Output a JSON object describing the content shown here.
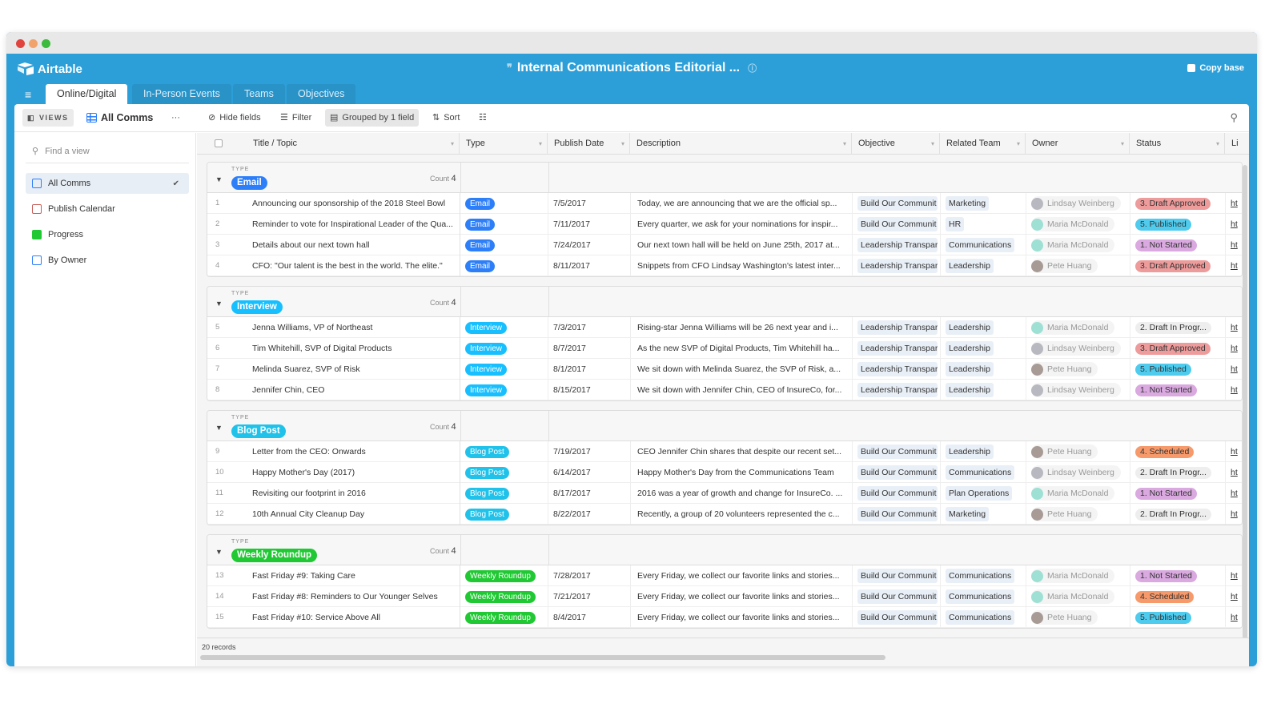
{
  "app": {
    "name": "Airtable",
    "base_title": "Internal Communications Editorial ...",
    "copy_base": "Copy base"
  },
  "tabs": [
    {
      "label": "Online/Digital",
      "active": true
    },
    {
      "label": "In-Person Events",
      "active": false
    },
    {
      "label": "Teams",
      "active": false
    },
    {
      "label": "Objectives",
      "active": false
    }
  ],
  "toolbar": {
    "views_label": "VIEWS",
    "current_view": "All Comms",
    "more": "···",
    "hide_fields": "Hide fields",
    "filter": "Filter",
    "grouped": "Grouped by 1 field",
    "sort": "Sort"
  },
  "sidebar": {
    "find_placeholder": "Find a view",
    "views": [
      {
        "label": "All Comms",
        "icon": "grid",
        "selected": true
      },
      {
        "label": "Publish Calendar",
        "icon": "calendar",
        "selected": false
      },
      {
        "label": "Progress",
        "icon": "kanban",
        "selected": false
      },
      {
        "label": "By Owner",
        "icon": "grid",
        "selected": false
      }
    ]
  },
  "columns": [
    "Title / Topic",
    "Type",
    "Publish Date",
    "Description",
    "Objective",
    "Related Team",
    "Owner",
    "Status",
    "Li"
  ],
  "colors": {
    "Email": "#2d7ff9",
    "Interview": "#18bfff",
    "Blog Post": "#20c2ea",
    "Weekly Roundup": "#20c933",
    "1. Not Started": "#d9a9e0",
    "2. Draft In Progr...": "#eeeeee",
    "3. Draft Approved": "#ee9b9b",
    "4. Scheduled": "#f79a6b",
    "5. Published": "#4fcbee",
    "Lindsay Weinberg": "#b8b8c0",
    "Maria McDonald": "#9ee0d3",
    "Pete Huang": "#a89b96"
  },
  "group_label": "TYPE",
  "count_label": "Count",
  "groups": [
    {
      "type": "Email",
      "count": "4",
      "rows": [
        {
          "n": "1",
          "title": "Announcing our sponsorship of the 2018 Steel Bowl",
          "date": "7/5/2017",
          "desc": "Today, we are announcing that we are the official sp...",
          "objective": "Build Our Communit",
          "team": "Marketing",
          "owner": "Lindsay Weinberg",
          "status": "3. Draft Approved"
        },
        {
          "n": "2",
          "title": "Reminder to vote for Inspirational Leader of the Qua...",
          "date": "7/11/2017",
          "desc": "Every quarter, we ask for your nominations for inspir...",
          "objective": "Build Our Communit",
          "team": "HR",
          "owner": "Maria McDonald",
          "status": "5. Published"
        },
        {
          "n": "3",
          "title": "Details about our next town hall",
          "date": "7/24/2017",
          "desc": "Our next town hall will be held on June 25th, 2017 at...",
          "objective": "Leadership Transpar",
          "team": "Communications",
          "owner": "Maria McDonald",
          "status": "1. Not Started"
        },
        {
          "n": "4",
          "title": "CFO: \"Our talent is the best in the world. The elite.\"",
          "date": "8/11/2017",
          "desc": "Snippets from CFO Lindsay Washington's latest inter...",
          "objective": "Leadership Transpar",
          "team": "Leadership",
          "owner": "Pete Huang",
          "status": "3. Draft Approved"
        }
      ]
    },
    {
      "type": "Interview",
      "count": "4",
      "rows": [
        {
          "n": "5",
          "title": "Jenna Williams, VP of Northeast",
          "date": "7/3/2017",
          "desc": "Rising-star Jenna Williams will be 26 next year and i...",
          "objective": "Leadership Transpar",
          "team": "Leadership",
          "owner": "Maria McDonald",
          "status": "2. Draft In Progr..."
        },
        {
          "n": "6",
          "title": "Tim Whitehill, SVP of Digital Products",
          "date": "8/7/2017",
          "desc": "As the new SVP of Digital Products, Tim Whitehill ha...",
          "objective": "Leadership Transpar",
          "team": "Leadership",
          "owner": "Lindsay Weinberg",
          "status": "3. Draft Approved"
        },
        {
          "n": "7",
          "title": "Melinda Suarez, SVP of Risk",
          "date": "8/1/2017",
          "desc": "We sit down with Melinda Suarez, the SVP of Risk, a...",
          "objective": "Leadership Transpar",
          "team": "Leadership",
          "owner": "Pete Huang",
          "status": "5. Published"
        },
        {
          "n": "8",
          "title": "Jennifer Chin, CEO",
          "date": "8/15/2017",
          "desc": "We sit down with Jennifer Chin, CEO of InsureCo, for...",
          "objective": "Leadership Transpar",
          "team": "Leadership",
          "owner": "Lindsay Weinberg",
          "status": "1. Not Started"
        }
      ]
    },
    {
      "type": "Blog Post",
      "count": "4",
      "rows": [
        {
          "n": "9",
          "title": "Letter from the CEO: Onwards",
          "date": "7/19/2017",
          "desc": "CEO Jennifer Chin shares that despite our recent set...",
          "objective": "Build Our Communit",
          "team": "Leadership",
          "owner": "Pete Huang",
          "status": "4. Scheduled"
        },
        {
          "n": "10",
          "title": "Happy Mother's Day (2017)",
          "date": "6/14/2017",
          "desc": "Happy Mother's Day from the Communications Team",
          "objective": "Build Our Communit",
          "team": "Communications",
          "owner": "Lindsay Weinberg",
          "status": "2. Draft In Progr..."
        },
        {
          "n": "11",
          "title": "Revisiting our footprint in 2016",
          "date": "8/17/2017",
          "desc": "2016 was a year of growth and change for InsureCo. ...",
          "objective": "Build Our Communit",
          "team": "Plan Operations",
          "owner": "Maria McDonald",
          "status": "1. Not Started"
        },
        {
          "n": "12",
          "title": "10th Annual City Cleanup Day",
          "date": "8/22/2017",
          "desc": "Recently, a group of 20 volunteers represented the c...",
          "objective": "Build Our Communit",
          "team": "Marketing",
          "owner": "Pete Huang",
          "status": "2. Draft In Progr..."
        }
      ]
    },
    {
      "type": "Weekly Roundup",
      "count": "4",
      "rows": [
        {
          "n": "13",
          "title": "Fast Friday #9: Taking Care",
          "date": "7/28/2017",
          "desc": "Every Friday, we collect our favorite links and stories...",
          "objective": "Build Our Communit",
          "team": "Communications",
          "owner": "Maria McDonald",
          "status": "1. Not Started"
        },
        {
          "n": "14",
          "title": "Fast Friday #8: Reminders to Our Younger Selves",
          "date": "7/21/2017",
          "desc": "Every Friday, we collect our favorite links and stories...",
          "objective": "Build Our Communit",
          "team": "Communications",
          "owner": "Maria McDonald",
          "status": "4. Scheduled"
        },
        {
          "n": "15",
          "title": "Fast Friday #10: Service Above All",
          "date": "8/4/2017",
          "desc": "Every Friday, we collect our favorite links and stories...",
          "objective": "Build Our Communit",
          "team": "Communications",
          "owner": "Pete Huang",
          "status": "5. Published"
        }
      ]
    }
  ],
  "link_stub": "ht",
  "footer": {
    "records": "20 records"
  }
}
